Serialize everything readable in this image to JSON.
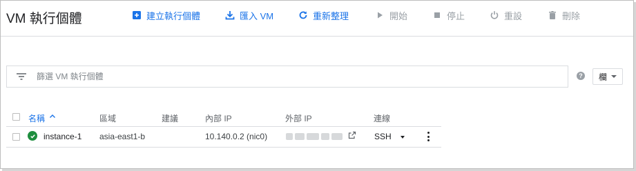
{
  "header": {
    "title": "VM 執行個體",
    "toolbar": [
      {
        "label": "建立執行個體",
        "icon": "add-box-icon",
        "state": "active"
      },
      {
        "label": "匯入 VM",
        "icon": "import-icon",
        "state": "active"
      },
      {
        "label": "重新整理",
        "icon": "refresh-icon",
        "state": "active"
      },
      {
        "label": "開始",
        "icon": "play-icon",
        "state": "disabled"
      },
      {
        "label": "停止",
        "icon": "stop-icon",
        "state": "disabled"
      },
      {
        "label": "重設",
        "icon": "power-icon",
        "state": "disabled"
      },
      {
        "label": "刪除",
        "icon": "trash-icon",
        "state": "disabled"
      }
    ]
  },
  "filter": {
    "placeholder": "篩選 VM 執行個體",
    "help_icon": "?",
    "columns_label": "欄"
  },
  "table": {
    "columns": [
      "名稱",
      "區域",
      "建議",
      "內部 IP",
      "外部 IP",
      "連線"
    ],
    "sorted_column": "名稱",
    "rows": [
      {
        "status": "running",
        "name": "instance-1",
        "zone": "asia-east1-b",
        "recommendation": "",
        "internal_ip": "10.140.0.2 (nic0)",
        "external_ip": "",
        "connect": "SSH"
      }
    ]
  },
  "colors": {
    "accent": "#1a73e8",
    "disabled": "#9aa0a6",
    "status_ok": "#1e8e3e"
  }
}
